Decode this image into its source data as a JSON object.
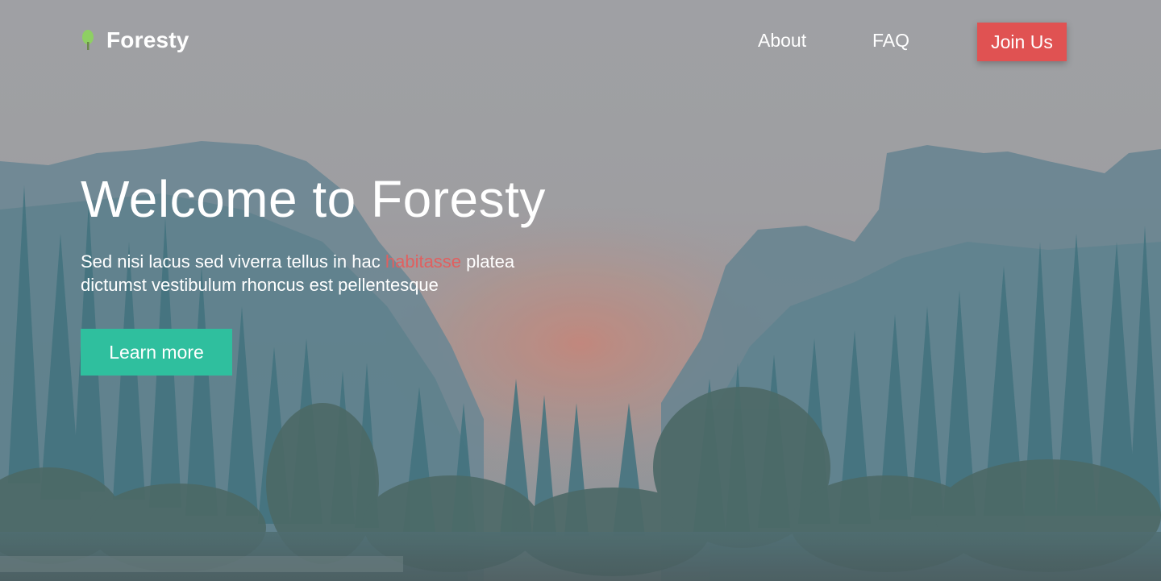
{
  "brand": {
    "name": "Foresty",
    "logo_icon": "tree-icon"
  },
  "nav": {
    "items": [
      {
        "label": "About"
      },
      {
        "label": "FAQ"
      }
    ],
    "cta_label": "Join Us"
  },
  "hero": {
    "title": "Welcome to Foresty",
    "subtitle_before": "Sed nisi lacus sed viverra tellus in hac ",
    "subtitle_highlight": "habitasse",
    "subtitle_after": " platea dictumst vestibulum rhoncus est pellentesque",
    "button_label": "Learn more",
    "background": "misty-forest-valley-photo"
  },
  "colors": {
    "accent_red": "#e05252",
    "accent_teal": "#2fbf9e",
    "highlight_text": "#e06060",
    "logo_green": "#8ecf63"
  }
}
